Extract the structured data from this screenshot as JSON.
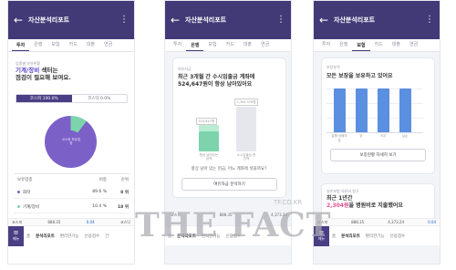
{
  "colors": {
    "header": "#413a77",
    "accent": "#5b46c8",
    "donut_main": "#7b61c7",
    "donut_minor": "#7dd3ab",
    "green_bar": "#7dd3ab",
    "blue_bar": "#5b8fe0",
    "pink": "#e24f8e"
  },
  "watermark": {
    "brand": "THE FACT",
    "url": "TF.CO.KR"
  },
  "screens": [
    {
      "title": "자산분석리포트",
      "tabs": [
        "투자",
        "은행",
        "보험",
        "카드",
        "대출",
        "연금"
      ],
      "subtitle": "업종별 보유현황",
      "headline_hl": "기계/장비",
      "headline_1": " 섹터는",
      "headline_2": "점검이 필요해 보여요.",
      "toggle": [
        "코스피 100.0%",
        "코스닥 0.0%"
      ],
      "donut_label": "코스피 보유업종",
      "table_headers": [
        "보유업종",
        "비중",
        "순위"
      ],
      "rows": [
        {
          "name": "화학",
          "share": "89.6 %",
          "rank": "8 위"
        },
        {
          "name": "기계/장비",
          "share": "10.4 %",
          "rank": "18 위"
        }
      ],
      "ticker": [
        "코스피",
        "888.35",
        "0.04",
        "코스닥"
      ],
      "nav": {
        "menu": "메뉴",
        "items": [
          "홈",
          "분석리포트",
          "편리한기능",
          "신용점수",
          "간"
        ]
      }
    },
    {
      "title": "자산분석리포트",
      "tabs": [
        "투자",
        "은행",
        "보험",
        "카드",
        "대출",
        "연금"
      ],
      "subtitle": "여유자금",
      "headline": "최근 3개월 간 수시입출금 계좌에 524,647원이 항상 남아있어요",
      "bars": [
        {
          "label": "항상 남아있는 금액",
          "value": "524,647원"
        },
        {
          "label": "수시입출금 총 잔액",
          "value": "2,364,978원"
        }
      ],
      "question": "항상 남아 있는 현금, 어느 계좌에 넣을까요?",
      "button": "여유자금 분석하기",
      "ticker": [
        "코스피",
        "888.35",
        "4,373.24"
      ],
      "nav": {
        "items": [
          "홈",
          "분석리포트",
          "편리한기능",
          "신용점수"
        ]
      }
    },
    {
      "title": "자산분석리포트",
      "tabs": [
        "투자",
        "은행",
        "보험",
        "카드",
        "대출",
        "연금"
      ],
      "subtitle": "보장분석",
      "headline": "모든 보장을 보유하고 있어요",
      "bar_labels": [
        "질병·상해보장",
        "암",
        "3대",
        "실손"
      ],
      "button": "보장현황 자세히 보기",
      "card2_subtitle": "실손보험 의료비 청구",
      "card2_line1": "최근 1년간",
      "card2_hl": "2,304원",
      "card2_line2": "을 병원비로 지출했어요",
      "ticker": [
        "코스피",
        "888.35",
        "4,373.24",
        "0.04"
      ],
      "nav": {
        "menu": "메뉴",
        "items": [
          "홈",
          "분석리포트",
          "편리한기능",
          "신용점수"
        ]
      }
    }
  ]
}
